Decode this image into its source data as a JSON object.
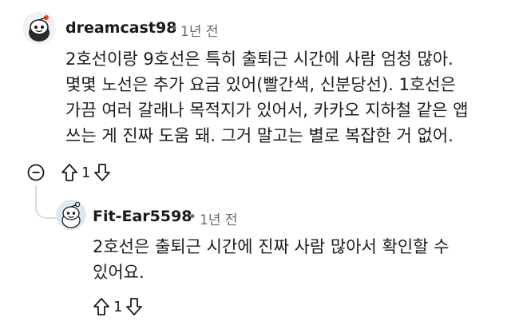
{
  "comments": [
    {
      "author": "dreamcast98",
      "separator": "•",
      "time": "1년 전",
      "avatar_icon": "avatar-snoo-dark",
      "lines": [
        "2호선이랑 9호선은 특히 출퇴근 시간에 사람 엄청 많아.",
        "몇몇 노선은 추가 요금 있어(빨간색, 신분당선). 1호선은",
        "가끔 여러 갈래나 목적지가 있어서, 카카오 지하철 같은 앱",
        "쓰는 게 진짜 도움 돼. 그거 말고는 별로 복잡한 거 없어."
      ],
      "votes": "1",
      "collapse_icon": "collapse-minus-icon",
      "upvote_icon": "upvote-arrow-icon",
      "downvote_icon": "downvote-arrow-icon"
    },
    {
      "author": "Fit-Ear5598",
      "separator": "•",
      "time": "1년 전",
      "avatar_icon": "avatar-snoo-light",
      "lines": [
        "2호선은 출퇴근 시간에 진짜 사람 많아서 확인할 수",
        "있어요."
      ],
      "votes": "1",
      "upvote_icon": "upvote-arrow-icon",
      "downvote_icon": "downvote-arrow-icon"
    }
  ],
  "colors": {
    "text": "#1c1c1c",
    "meta": "#6b6b6b",
    "thread_line": "#dcdcdc"
  }
}
